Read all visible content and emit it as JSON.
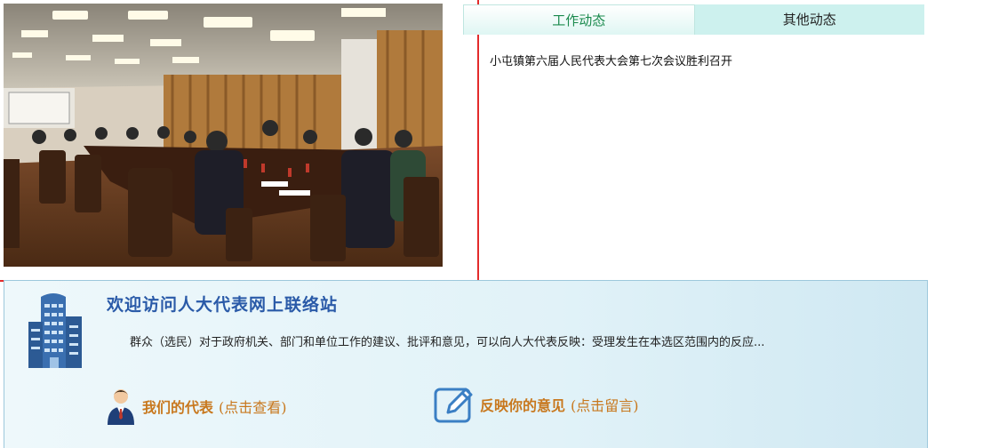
{
  "tabs": [
    {
      "label": "工作动态",
      "active": true
    },
    {
      "label": "其他动态",
      "active": false
    }
  ],
  "news": [
    {
      "title": "小屯镇第六届人民代表大会第七次会议胜利召开"
    }
  ],
  "welcome": {
    "title": "欢迎访问人大代表网上联络站",
    "description": "群众（选民）对于政府机关、部门和单位工作的建议、批评和意见，可以向人大代表反映：受理发生在本选区范围内的反应...",
    "links": [
      {
        "strong": "我们的代表",
        "hint": "(点击查看)"
      },
      {
        "strong": "反映你的意见",
        "hint": "(点击留言)"
      }
    ]
  },
  "colors": {
    "accent_red": "#e32b2b",
    "tab_active_text": "#1a8a4d",
    "tab_bg": "#cdf1ee",
    "title_blue": "#2a5aa8",
    "link_orange": "#c8781e"
  },
  "icons": [
    "building-icon",
    "representative-avatar-icon",
    "edit-message-icon"
  ]
}
